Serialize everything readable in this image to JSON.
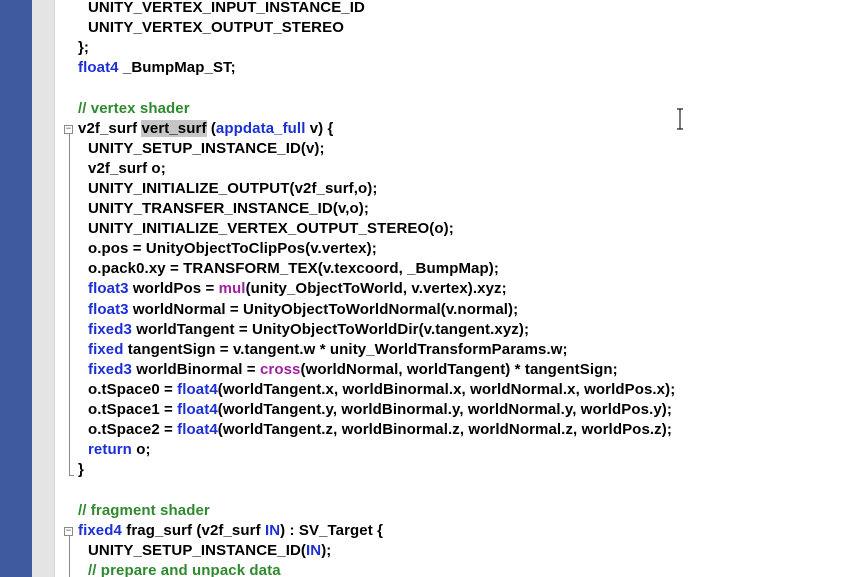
{
  "colors": {
    "keyword": "#1b2fd6",
    "builtin_function": "#a320a0",
    "comment": "#2f8a2f",
    "plain": "#000000",
    "selection_highlight": "#c6c6c6",
    "left_bar": "#3f5a9e",
    "gutter": "#e4e4e4"
  },
  "cursor_icon": "i-beam-cursor",
  "fold_icon": "minus-fold-icon",
  "lines": [
    {
      "indent": 1,
      "tokens": [
        {
          "t": "UNITY_VERTEX_INPUT_INSTANCE_ID"
        }
      ]
    },
    {
      "indent": 1,
      "tokens": [
        {
          "t": "UNITY_VERTEX_OUTPUT_STEREO"
        }
      ]
    },
    {
      "indent": 0,
      "tokens": [
        {
          "t": "};"
        }
      ]
    },
    {
      "indent": 0,
      "tokens": [
        {
          "t": "float4",
          "c": "kw"
        },
        {
          "t": " _BumpMap_ST;"
        }
      ]
    },
    {
      "indent": 0,
      "tokens": []
    },
    {
      "indent": 0,
      "tokens": [
        {
          "t": "// vertex shader",
          "c": "cm"
        }
      ]
    },
    {
      "indent": 0,
      "fold": true,
      "tokens": [
        {
          "t": "v2f_surf "
        },
        {
          "t": "vert_surf",
          "c": "hl"
        },
        {
          "t": " ("
        },
        {
          "t": "appdata_full",
          "c": "kw"
        },
        {
          "t": " v) {"
        }
      ]
    },
    {
      "indent": 1,
      "tokens": [
        {
          "t": "UNITY_SETUP_INSTANCE_ID(v);"
        }
      ]
    },
    {
      "indent": 1,
      "tokens": [
        {
          "t": "v2f_surf o;"
        }
      ]
    },
    {
      "indent": 1,
      "tokens": [
        {
          "t": "UNITY_INITIALIZE_OUTPUT(v2f_surf,o);"
        }
      ]
    },
    {
      "indent": 1,
      "tokens": [
        {
          "t": "UNITY_TRANSFER_INSTANCE_ID(v,o);"
        }
      ]
    },
    {
      "indent": 1,
      "tokens": [
        {
          "t": "UNITY_INITIALIZE_VERTEX_OUTPUT_STEREO(o);"
        }
      ]
    },
    {
      "indent": 1,
      "tokens": [
        {
          "t": "o.pos = UnityObjectToClipPos(v.vertex);"
        }
      ]
    },
    {
      "indent": 1,
      "tokens": [
        {
          "t": "o.pack0.xy = TRANSFORM_TEX(v.texcoord, _BumpMap);"
        }
      ]
    },
    {
      "indent": 1,
      "tokens": [
        {
          "t": "float3",
          "c": "kw"
        },
        {
          "t": " worldPos = "
        },
        {
          "t": "mul",
          "c": "fn"
        },
        {
          "t": "(unity_ObjectToWorld, v.vertex).xyz;"
        }
      ]
    },
    {
      "indent": 1,
      "tokens": [
        {
          "t": "float3",
          "c": "kw"
        },
        {
          "t": " worldNormal = UnityObjectToWorldNormal(v.normal);"
        }
      ]
    },
    {
      "indent": 1,
      "tokens": [
        {
          "t": "fixed3",
          "c": "kw"
        },
        {
          "t": " worldTangent = UnityObjectToWorldDir(v.tangent.xyz);"
        }
      ]
    },
    {
      "indent": 1,
      "tokens": [
        {
          "t": "fixed",
          "c": "kw"
        },
        {
          "t": " tangentSign = v.tangent.w * unity_WorldTransformParams.w;"
        }
      ]
    },
    {
      "indent": 1,
      "tokens": [
        {
          "t": "fixed3",
          "c": "kw"
        },
        {
          "t": " worldBinormal = "
        },
        {
          "t": "cross",
          "c": "fn"
        },
        {
          "t": "(worldNormal, worldTangent) * tangentSign;"
        }
      ]
    },
    {
      "indent": 1,
      "tokens": [
        {
          "t": "o.tSpace0 = "
        },
        {
          "t": "float4",
          "c": "kw"
        },
        {
          "t": "(worldTangent.x, worldBinormal.x, worldNormal.x, worldPos.x);"
        }
      ]
    },
    {
      "indent": 1,
      "tokens": [
        {
          "t": "o.tSpace1 = "
        },
        {
          "t": "float4",
          "c": "kw"
        },
        {
          "t": "(worldTangent.y, worldBinormal.y, worldNormal.y, worldPos.y);"
        }
      ]
    },
    {
      "indent": 1,
      "tokens": [
        {
          "t": "o.tSpace2 = "
        },
        {
          "t": "float4",
          "c": "kw"
        },
        {
          "t": "(worldTangent.z, worldBinormal.z, worldNormal.z, worldPos.z);"
        }
      ]
    },
    {
      "indent": 1,
      "tokens": [
        {
          "t": "return",
          "c": "kw"
        },
        {
          "t": " o;"
        }
      ]
    },
    {
      "indent": 0,
      "tokens": [
        {
          "t": "}"
        }
      ]
    },
    {
      "indent": 0,
      "tokens": []
    },
    {
      "indent": 0,
      "tokens": [
        {
          "t": "// fragment shader",
          "c": "cm"
        }
      ]
    },
    {
      "indent": 0,
      "fold": true,
      "tokens": [
        {
          "t": "fixed4",
          "c": "kw"
        },
        {
          "t": " frag_surf (v2f_surf "
        },
        {
          "t": "IN",
          "c": "kw"
        },
        {
          "t": ") : SV_Target {"
        }
      ]
    },
    {
      "indent": 1,
      "tokens": [
        {
          "t": "UNITY_SETUP_INSTANCE_ID("
        },
        {
          "t": "IN",
          "c": "kw"
        },
        {
          "t": ");"
        }
      ]
    },
    {
      "indent": 1,
      "tokens": [
        {
          "t": "// prepare and unpack data",
          "c": "cm"
        }
      ]
    }
  ]
}
